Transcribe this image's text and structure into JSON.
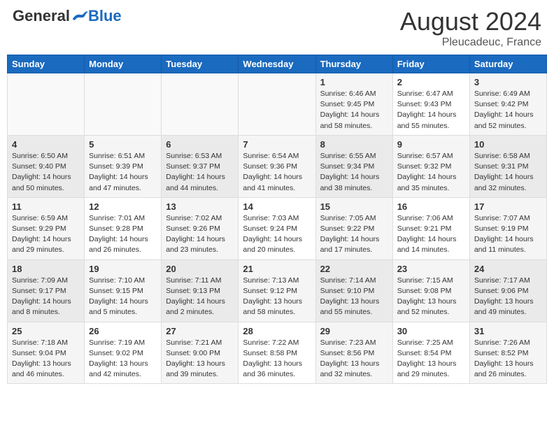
{
  "header": {
    "logo_general": "General",
    "logo_blue": "Blue",
    "month_year": "August 2024",
    "location": "Pleucadeuc, France"
  },
  "weekdays": [
    "Sunday",
    "Monday",
    "Tuesday",
    "Wednesday",
    "Thursday",
    "Friday",
    "Saturday"
  ],
  "weeks": [
    [
      {
        "day": "",
        "info": ""
      },
      {
        "day": "",
        "info": ""
      },
      {
        "day": "",
        "info": ""
      },
      {
        "day": "",
        "info": ""
      },
      {
        "day": "1",
        "info": "Sunrise: 6:46 AM\nSunset: 9:45 PM\nDaylight: 14 hours\nand 58 minutes."
      },
      {
        "day": "2",
        "info": "Sunrise: 6:47 AM\nSunset: 9:43 PM\nDaylight: 14 hours\nand 55 minutes."
      },
      {
        "day": "3",
        "info": "Sunrise: 6:49 AM\nSunset: 9:42 PM\nDaylight: 14 hours\nand 52 minutes."
      }
    ],
    [
      {
        "day": "4",
        "info": "Sunrise: 6:50 AM\nSunset: 9:40 PM\nDaylight: 14 hours\nand 50 minutes."
      },
      {
        "day": "5",
        "info": "Sunrise: 6:51 AM\nSunset: 9:39 PM\nDaylight: 14 hours\nand 47 minutes."
      },
      {
        "day": "6",
        "info": "Sunrise: 6:53 AM\nSunset: 9:37 PM\nDaylight: 14 hours\nand 44 minutes."
      },
      {
        "day": "7",
        "info": "Sunrise: 6:54 AM\nSunset: 9:36 PM\nDaylight: 14 hours\nand 41 minutes."
      },
      {
        "day": "8",
        "info": "Sunrise: 6:55 AM\nSunset: 9:34 PM\nDaylight: 14 hours\nand 38 minutes."
      },
      {
        "day": "9",
        "info": "Sunrise: 6:57 AM\nSunset: 9:32 PM\nDaylight: 14 hours\nand 35 minutes."
      },
      {
        "day": "10",
        "info": "Sunrise: 6:58 AM\nSunset: 9:31 PM\nDaylight: 14 hours\nand 32 minutes."
      }
    ],
    [
      {
        "day": "11",
        "info": "Sunrise: 6:59 AM\nSunset: 9:29 PM\nDaylight: 14 hours\nand 29 minutes."
      },
      {
        "day": "12",
        "info": "Sunrise: 7:01 AM\nSunset: 9:28 PM\nDaylight: 14 hours\nand 26 minutes."
      },
      {
        "day": "13",
        "info": "Sunrise: 7:02 AM\nSunset: 9:26 PM\nDaylight: 14 hours\nand 23 minutes."
      },
      {
        "day": "14",
        "info": "Sunrise: 7:03 AM\nSunset: 9:24 PM\nDaylight: 14 hours\nand 20 minutes."
      },
      {
        "day": "15",
        "info": "Sunrise: 7:05 AM\nSunset: 9:22 PM\nDaylight: 14 hours\nand 17 minutes."
      },
      {
        "day": "16",
        "info": "Sunrise: 7:06 AM\nSunset: 9:21 PM\nDaylight: 14 hours\nand 14 minutes."
      },
      {
        "day": "17",
        "info": "Sunrise: 7:07 AM\nSunset: 9:19 PM\nDaylight: 14 hours\nand 11 minutes."
      }
    ],
    [
      {
        "day": "18",
        "info": "Sunrise: 7:09 AM\nSunset: 9:17 PM\nDaylight: 14 hours\nand 8 minutes."
      },
      {
        "day": "19",
        "info": "Sunrise: 7:10 AM\nSunset: 9:15 PM\nDaylight: 14 hours\nand 5 minutes."
      },
      {
        "day": "20",
        "info": "Sunrise: 7:11 AM\nSunset: 9:13 PM\nDaylight: 14 hours\nand 2 minutes."
      },
      {
        "day": "21",
        "info": "Sunrise: 7:13 AM\nSunset: 9:12 PM\nDaylight: 13 hours\nand 58 minutes."
      },
      {
        "day": "22",
        "info": "Sunrise: 7:14 AM\nSunset: 9:10 PM\nDaylight: 13 hours\nand 55 minutes."
      },
      {
        "day": "23",
        "info": "Sunrise: 7:15 AM\nSunset: 9:08 PM\nDaylight: 13 hours\nand 52 minutes."
      },
      {
        "day": "24",
        "info": "Sunrise: 7:17 AM\nSunset: 9:06 PM\nDaylight: 13 hours\nand 49 minutes."
      }
    ],
    [
      {
        "day": "25",
        "info": "Sunrise: 7:18 AM\nSunset: 9:04 PM\nDaylight: 13 hours\nand 46 minutes."
      },
      {
        "day": "26",
        "info": "Sunrise: 7:19 AM\nSunset: 9:02 PM\nDaylight: 13 hours\nand 42 minutes."
      },
      {
        "day": "27",
        "info": "Sunrise: 7:21 AM\nSunset: 9:00 PM\nDaylight: 13 hours\nand 39 minutes."
      },
      {
        "day": "28",
        "info": "Sunrise: 7:22 AM\nSunset: 8:58 PM\nDaylight: 13 hours\nand 36 minutes."
      },
      {
        "day": "29",
        "info": "Sunrise: 7:23 AM\nSunset: 8:56 PM\nDaylight: 13 hours\nand 32 minutes."
      },
      {
        "day": "30",
        "info": "Sunrise: 7:25 AM\nSunset: 8:54 PM\nDaylight: 13 hours\nand 29 minutes."
      },
      {
        "day": "31",
        "info": "Sunrise: 7:26 AM\nSunset: 8:52 PM\nDaylight: 13 hours\nand 26 minutes."
      }
    ]
  ]
}
